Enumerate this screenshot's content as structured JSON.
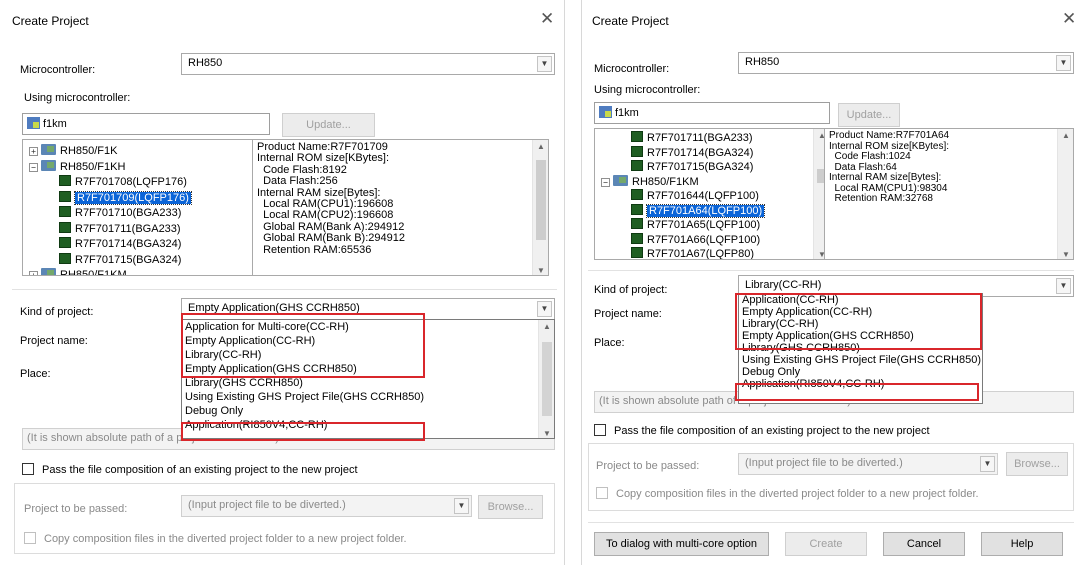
{
  "left": {
    "title": "Create Project",
    "microcontroller_label": "Microcontroller:",
    "microcontroller_value": "RH850",
    "using_label": "Using microcontroller:",
    "search_value": "f1km",
    "update_label": "Update...",
    "tree": [
      {
        "text": "RH850/F1K",
        "kind": "folder",
        "exp": "+"
      },
      {
        "text": "RH850/F1KH",
        "kind": "folder",
        "exp": "-"
      },
      {
        "text": "R7F701708(LQFP176)",
        "kind": "chip"
      },
      {
        "text": "R7F701709(LQFP176)",
        "kind": "chip",
        "selected": true
      },
      {
        "text": "R7F701710(BGA233)",
        "kind": "chip"
      },
      {
        "text": "R7F701711(BGA233)",
        "kind": "chip"
      },
      {
        "text": "R7F701714(BGA324)",
        "kind": "chip"
      },
      {
        "text": "R7F701715(BGA324)",
        "kind": "chip"
      },
      {
        "text": "RH850/F1KM",
        "kind": "folder",
        "exp": "+"
      }
    ],
    "info_text": "Product Name:R7F701709\nInternal ROM size[KBytes]:\n  Code Flash:8192\n  Data Flash:256\nInternal RAM size[Bytes]:\n  Local RAM(CPU1):196608\n  Local RAM(CPU2):196608\n  Global RAM(Bank A):294912\n  Global RAM(Bank B):294912\n  Retention RAM:65536",
    "kind_label": "Kind of project:",
    "kind_value": "Empty Application(GHS CCRH850)",
    "project_name_label": "Project name:",
    "place_label": "Place:",
    "dropdown": [
      "Application for Multi-core(CC-RH)",
      "Empty Application(CC-RH)",
      "Library(CC-RH)",
      "Empty Application(GHS CCRH850)",
      "Library(GHS CCRH850)",
      "Using Existing GHS Project File(GHS CCRH850)",
      "Debug Only",
      "Application(RI850V4,CC-RH)"
    ],
    "path_hint": "(It is shown absolute path of a project file to create.)",
    "pass_label": "Pass the file composition of an existing project to the new project",
    "project_to_pass_label": "Project to be passed:",
    "project_to_pass_placeholder": "(Input project file to be diverted.)",
    "browse_label": "Browse...",
    "copy_label": "Copy composition files in the diverted project folder to a new project folder."
  },
  "right": {
    "title": "Create Project",
    "microcontroller_label": "Microcontroller:",
    "microcontroller_value": "RH850",
    "using_label": "Using microcontroller:",
    "search_value": "f1km",
    "update_label": "Update...",
    "tree": [
      {
        "text": "R7F701711(BGA233)",
        "kind": "chip"
      },
      {
        "text": "R7F701714(BGA324)",
        "kind": "chip"
      },
      {
        "text": "R7F701715(BGA324)",
        "kind": "chip"
      },
      {
        "text": "RH850/F1KM",
        "kind": "folder",
        "exp": "-"
      },
      {
        "text": "R7F701644(LQFP100)",
        "kind": "chip"
      },
      {
        "text": "R7F701A64(LQFP100)",
        "kind": "chip",
        "selected": true
      },
      {
        "text": "R7F701A65(LQFP100)",
        "kind": "chip"
      },
      {
        "text": "R7F701A66(LQFP100)",
        "kind": "chip"
      },
      {
        "text": "R7F701A67(LQFP80)",
        "kind": "chip"
      }
    ],
    "info_text": "Product Name:R7F701A64\nInternal ROM size[KBytes]:\n  Code Flash:1024\n  Data Flash:64\nInternal RAM size[Bytes]:\n  Local RAM(CPU1):98304\n  Retention RAM:32768",
    "kind_label": "Kind of project:",
    "kind_value": "Library(CC-RH)",
    "project_name_label": "Project name:",
    "place_label": "Place:",
    "dropdown": [
      "Application(CC-RH)",
      "Empty Application(CC-RH)",
      "Library(CC-RH)",
      "Empty Application(GHS CCRH850)",
      "Library(GHS CCRH850)",
      "Using Existing GHS Project File(GHS CCRH850)",
      "Debug Only",
      "Application(RI850V4,CC-RH)"
    ],
    "path_hint": "(It is shown absolute path of a project file to create.)",
    "pass_label": "Pass the file composition of an existing project to the new project",
    "project_to_pass_label": "Project to be passed:",
    "project_to_pass_placeholder": "(Input project file to be diverted.)",
    "browse_label": "Browse...",
    "copy_label": "Copy composition files in the diverted project folder to a new project folder.",
    "multicore_label": "To dialog with multi-core option",
    "create_label": "Create",
    "cancel_label": "Cancel",
    "help_label": "Help"
  }
}
